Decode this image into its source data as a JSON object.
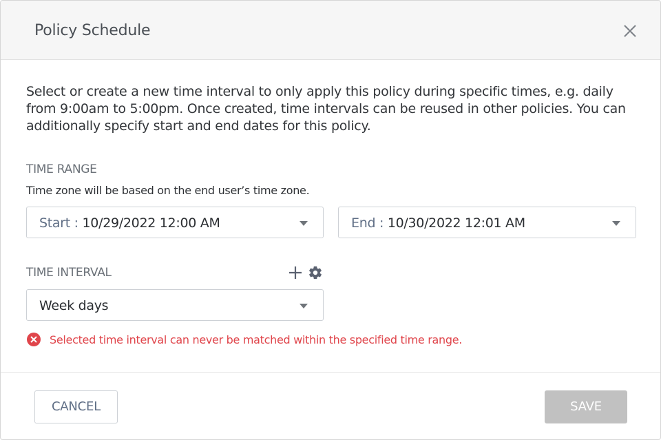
{
  "dialog": {
    "title": "Policy Schedule"
  },
  "description": "Select or create a new time interval to only apply this policy during specific times, e.g. daily from 9:00am to 5:00pm. Once created, time intervals can be reused in other policies. You can additionally specify start and end dates for this policy.",
  "time_range": {
    "label": "TIME RANGE",
    "hint": "Time zone will be based on the end user’s time zone.",
    "start_prefix": "Start :",
    "start_value": "10/29/2022 12:00 AM",
    "end_prefix": "End :",
    "end_value": "10/30/2022 12:01 AM"
  },
  "time_interval": {
    "label": "TIME INTERVAL",
    "selected": "Week days",
    "error": "Selected time interval can never be matched within the specified time range."
  },
  "footer": {
    "cancel_label": "CANCEL",
    "save_label": "SAVE"
  },
  "colors": {
    "error": "#e0454b",
    "save_disabled": "#c1c1c1",
    "accent_text": "#5f6e85"
  },
  "icons": {
    "close": "close-icon",
    "add": "plus-icon",
    "settings": "gear-icon",
    "error": "error-circle-icon",
    "caret": "chevron-down-icon"
  }
}
